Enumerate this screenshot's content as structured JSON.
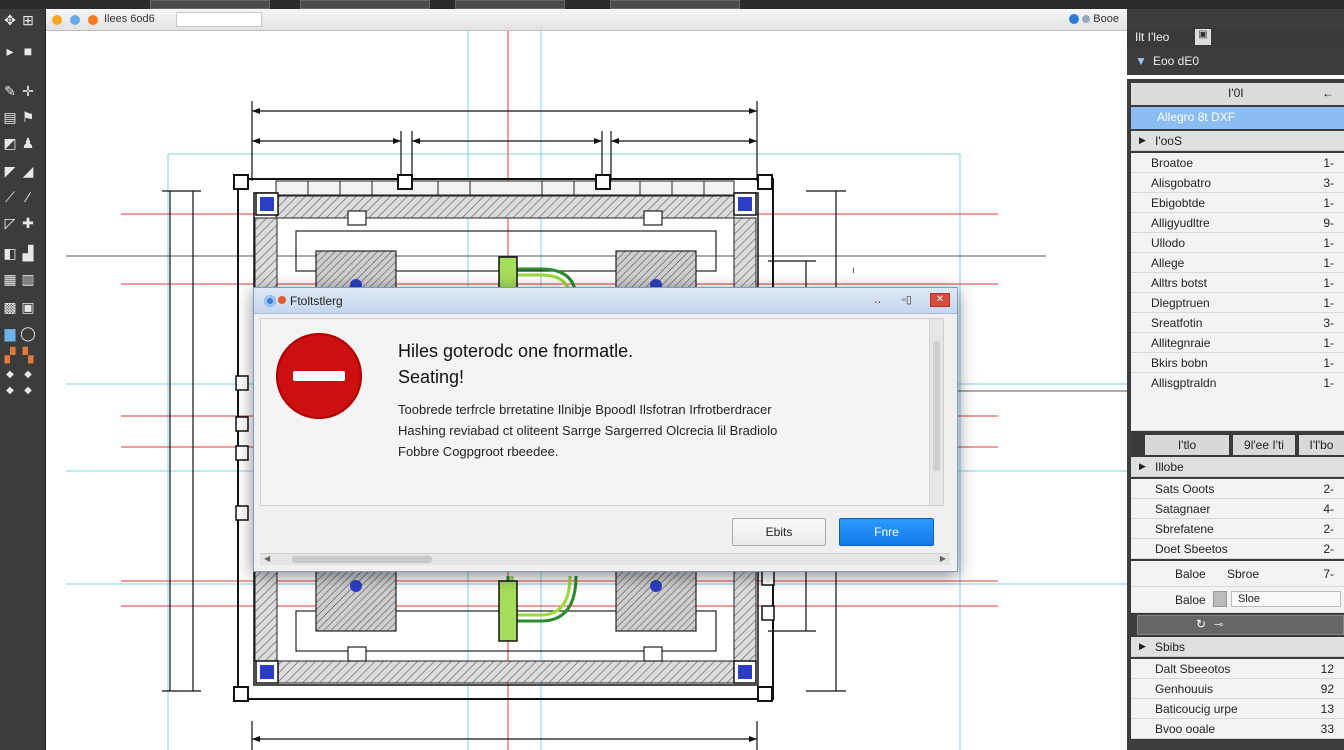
{
  "app": {
    "topbar_segments": 4
  },
  "document": {
    "tab_title": "Ilees 6od6",
    "right_label": "Booe"
  },
  "right_panel": {
    "header_title": "Ilt I'leo",
    "subheader": "Eoo dE0",
    "tab_label": "I'0I",
    "selected_item": "Allegro 8t DXF",
    "section1": "I'ooS",
    "layers": [
      {
        "label": "Broatoe",
        "value": "1-"
      },
      {
        "label": "Alisgobatro",
        "value": "3-"
      },
      {
        "label": "Ebigobtde",
        "value": "1-"
      },
      {
        "label": "Alligyudltre",
        "value": "9-"
      },
      {
        "label": "Ullodo",
        "value": "1-"
      },
      {
        "label": "Allege",
        "value": "1-"
      },
      {
        "label": "Alltrs botst",
        "value": "1-"
      },
      {
        "label": "Dlegptruen",
        "value": "1-"
      },
      {
        "label": "Sreatfotin",
        "value": "3-"
      },
      {
        "label": "Allitegnraie",
        "value": "1-"
      },
      {
        "label": "Bkirs bobn",
        "value": "1-"
      },
      {
        "label": "Allisgptraldn",
        "value": "1-"
      }
    ],
    "tabs": [
      "I'tlo",
      "9l'ee I'ti",
      "I'l'bo"
    ],
    "section2": "Illobe",
    "props": [
      {
        "label": "Sats Ooots",
        "value": "2-"
      },
      {
        "label": "Satagnaer",
        "value": "4-"
      },
      {
        "label": "Sbrefatene",
        "value": "2-"
      },
      {
        "label": "Doet Sbeetos",
        "value": "2-"
      }
    ],
    "prop_indent1": {
      "label": "Baloe",
      "extra": "Sbroe",
      "value": "7-"
    },
    "prop_indent2": {
      "label": "Baloe",
      "field": "Sloe"
    },
    "section3": "Sbibs",
    "props2": [
      {
        "label": "Dalt Sbeeotos",
        "value": "12"
      },
      {
        "label": "Genhouuis",
        "value": "92"
      },
      {
        "label": "Baticoucig urpe",
        "value": "13"
      },
      {
        "label": "Bvoo ooale",
        "value": "33"
      }
    ]
  },
  "dialog": {
    "title": "Ftoltstlerg",
    "heading1": "Hiles goterodc one fnormatle.",
    "heading2": "Seating!",
    "body_lines": [
      "Toobrede terfrcle brretatine Ilnibje Bpoodl Ilsfotran Irfrotberdracer",
      "Hashing reviabad ct oliteent Sarrge Sargerred Olcrecia lil Bradiolo",
      "Fobbre Cogpgroot rbeedee."
    ],
    "cancel_label": "Ebits",
    "ok_label": "Fnre"
  },
  "colors": {
    "accent": "#1a86f0",
    "stop_red": "#cc0f0f",
    "guide_red": "#e0383a",
    "guide_cyan": "#7fd3e6",
    "selection_blue": "#8bbdf3"
  }
}
